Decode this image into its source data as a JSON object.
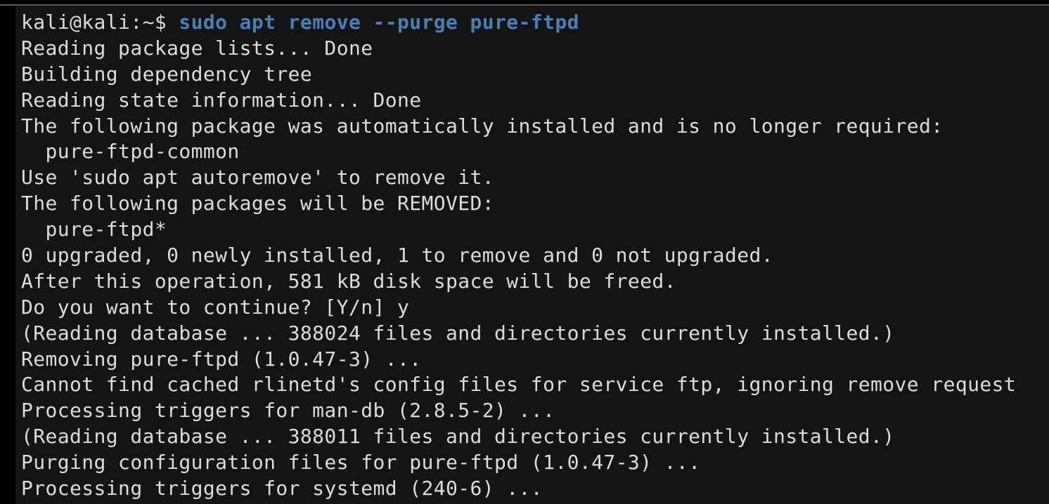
{
  "terminal": {
    "prompt": "kali@kali:~$ ",
    "command": "sudo apt remove --purge pure-ftpd",
    "colors": {
      "background": "#131416",
      "text": "#dcdcdc",
      "command": "#4a7fb5"
    },
    "output": [
      "Reading package lists... Done",
      "Building dependency tree",
      "Reading state information... Done",
      "The following package was automatically installed and is no longer required:",
      "  pure-ftpd-common",
      "Use 'sudo apt autoremove' to remove it.",
      "The following packages will be REMOVED:",
      "  pure-ftpd*",
      "0 upgraded, 0 newly installed, 1 to remove and 0 not upgraded.",
      "After this operation, 581 kB disk space will be freed.",
      "Do you want to continue? [Y/n] y",
      "(Reading database ... 388024 files and directories currently installed.)",
      "Removing pure-ftpd (1.0.47-3) ...",
      "Cannot find cached rlinetd's config files for service ftp, ignoring remove request",
      "Processing triggers for man-db (2.8.5-2) ...",
      "(Reading database ... 388011 files and directories currently installed.)",
      "Purging configuration files for pure-ftpd (1.0.47-3) ...",
      "Processing triggers for systemd (240-6) ..."
    ]
  }
}
